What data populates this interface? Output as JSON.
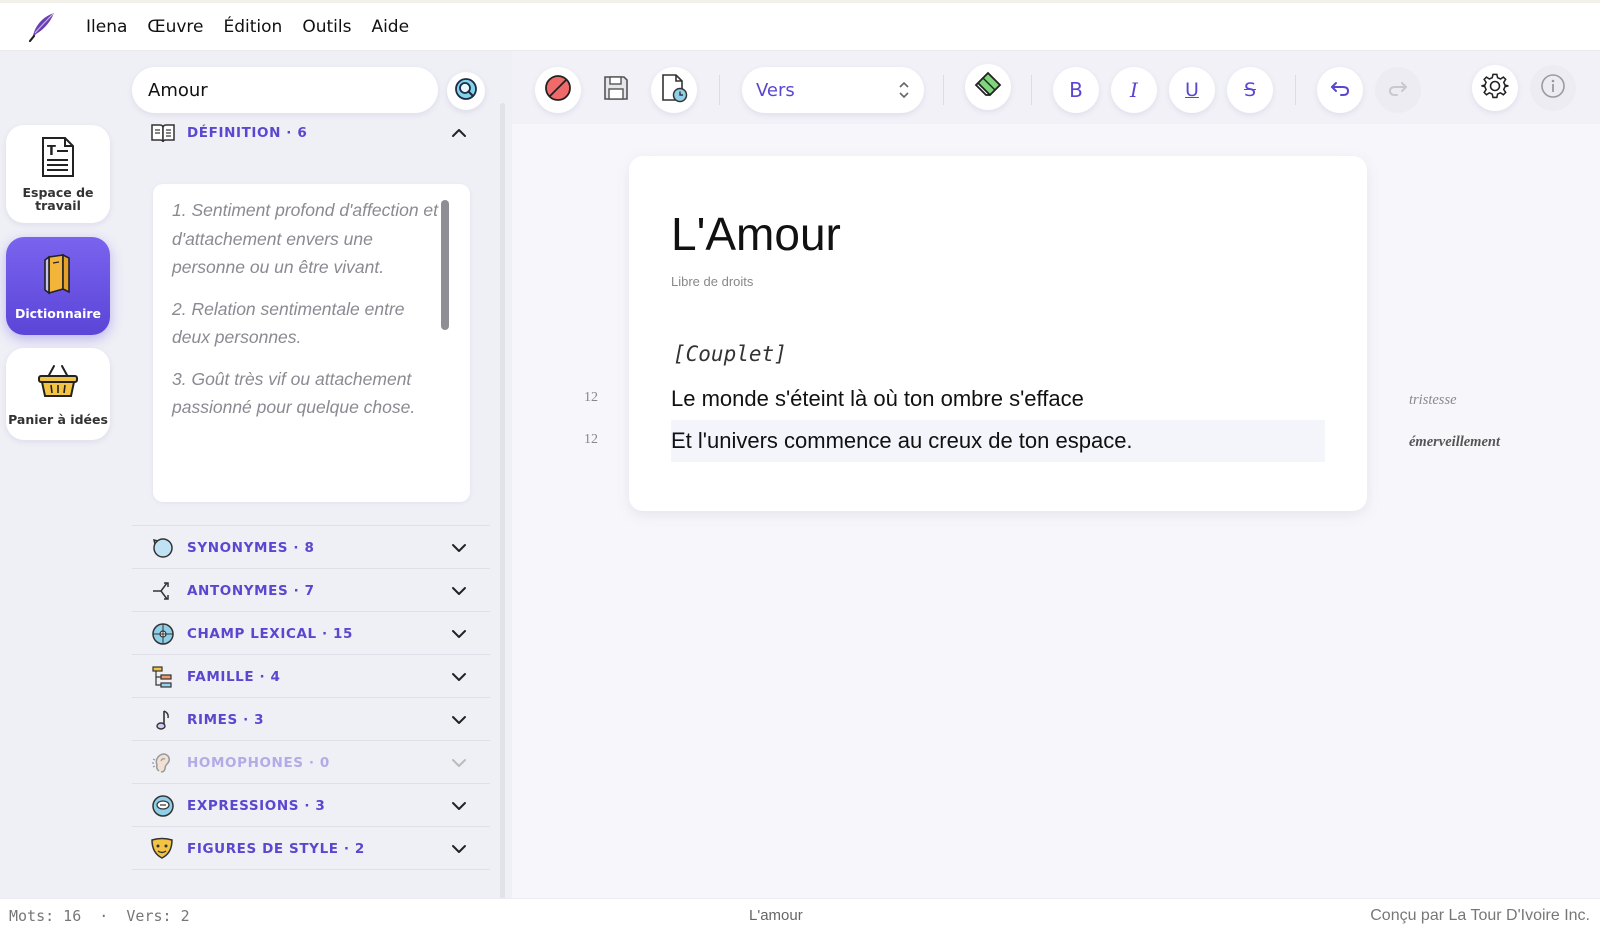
{
  "menubar": {
    "items": [
      "Ilena",
      "Œuvre",
      "Édition",
      "Outils",
      "Aide"
    ]
  },
  "sidebar": {
    "items": [
      {
        "label": "Espace de travail",
        "icon": "document-text-icon",
        "active": false
      },
      {
        "label": "Dictionnaire",
        "icon": "book-icon",
        "active": true
      },
      {
        "label": "Panier à idées",
        "icon": "basket-icon",
        "active": false
      }
    ]
  },
  "dictionary": {
    "search_value": "Amour",
    "sections": [
      {
        "title": "DÉFINITION · 6",
        "icon": "book-open-icon",
        "expanded": true
      },
      {
        "title": "SYNONYMES · 8",
        "icon": "cycle-icon"
      },
      {
        "title": "ANTONYMES · 7",
        "icon": "split-arrow-icon"
      },
      {
        "title": "CHAMP LEXICAL · 15",
        "icon": "globe-icon"
      },
      {
        "title": "FAMILLE · 4",
        "icon": "family-tree-icon"
      },
      {
        "title": "RIMES · 3",
        "icon": "music-note-icon"
      },
      {
        "title": "HOMOPHONES · 0",
        "icon": "ear-icon",
        "disabled": true
      },
      {
        "title": "EXPRESSIONS · 3",
        "icon": "speech-bubble-icon"
      },
      {
        "title": "FIGURES DE STYLE · 2",
        "icon": "theater-masks-icon"
      }
    ],
    "definitions": [
      "1. Sentiment profond d'affection et d'attachement envers une personne ou un être vivant.",
      "2. Relation sentimentale entre deux personnes.",
      "3. Goût très vif ou attachement passionné pour quelque chose."
    ]
  },
  "toolbar": {
    "format_select": "Vers",
    "bold": "B",
    "italic": "I",
    "underline": "U",
    "strike": "S"
  },
  "document": {
    "title": "L'Amour",
    "license": "Libre de droits",
    "section_tag": "[Couplet]",
    "verses": [
      {
        "text": "Le monde s'éteint là où ton ombre s'efface",
        "syllables": "12",
        "emotion": "tristesse"
      },
      {
        "text": "Et l'univers commence au creux de ton espace.",
        "syllables": "12",
        "emotion": "émerveillement"
      }
    ]
  },
  "status": {
    "left": "Mots: 16  ·  Vers: 2",
    "center": "L'amour",
    "right": "Conçu par La Tour D'Ivoire Inc."
  },
  "colors": {
    "accent": "#5a47cf",
    "active_nav": "#6a54e6",
    "emotion_sad": "#8a8a8a",
    "emotion_wonder": "#555555"
  }
}
